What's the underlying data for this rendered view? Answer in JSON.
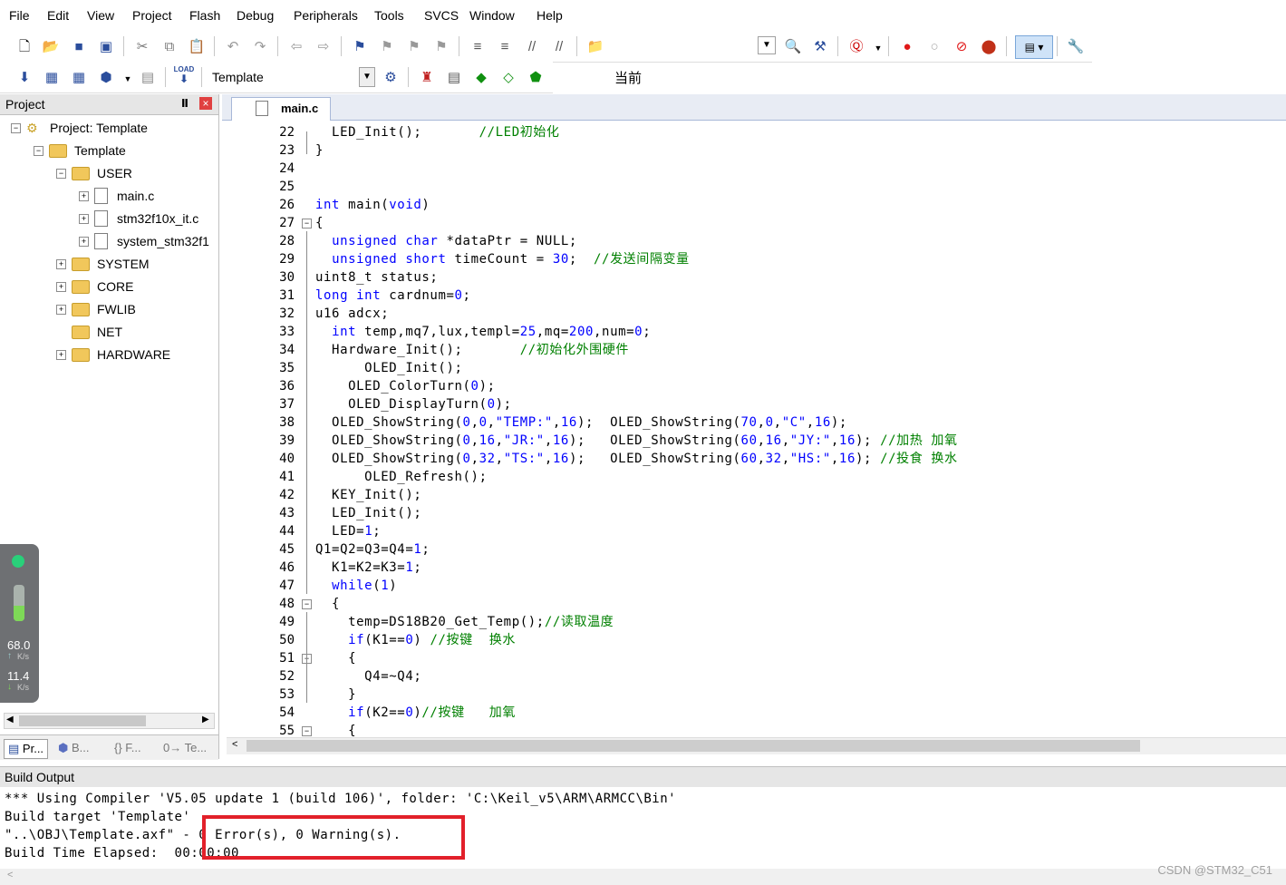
{
  "menu": [
    "File",
    "Edit",
    "View",
    "Project",
    "Flash",
    "Debug",
    "Peripherals",
    "Tools",
    "SVCS",
    "Window",
    "Help"
  ],
  "toolbar1": {
    "combo_value": "当前"
  },
  "toolbar2": {
    "target_combo": "Template",
    "load_label": "LOAD"
  },
  "project_panel": {
    "title": "Project",
    "pin_glyph": "Ⅱ",
    "close_glyph": "×",
    "tree": [
      {
        "label": "Project: Template",
        "level": 0,
        "type": "project",
        "expanded": true
      },
      {
        "label": "Template",
        "level": 1,
        "type": "target",
        "expanded": true
      },
      {
        "label": "USER",
        "level": 2,
        "type": "folder",
        "expanded": true
      },
      {
        "label": "main.c",
        "level": 3,
        "type": "file"
      },
      {
        "label": "stm32f10x_it.c",
        "level": 3,
        "type": "file"
      },
      {
        "label": "system_stm32f1",
        "level": 3,
        "type": "file"
      },
      {
        "label": "SYSTEM",
        "level": 2,
        "type": "folder",
        "expanded": false
      },
      {
        "label": "CORE",
        "level": 2,
        "type": "folder",
        "expanded": false
      },
      {
        "label": "FWLIB",
        "level": 2,
        "type": "folder",
        "expanded": false
      },
      {
        "label": "NET",
        "level": 2,
        "type": "folder",
        "expanded": null
      },
      {
        "label": "HARDWARE",
        "level": 2,
        "type": "folder",
        "expanded": false
      }
    ],
    "tabs": [
      "Pr...",
      "B...",
      "{} F...",
      "0→ Te..."
    ]
  },
  "net_widget": {
    "up_value": "68.0",
    "up_unit": "K/s",
    "down_value": "11.4",
    "down_unit": "K/s"
  },
  "editor": {
    "active_tab": "main.c",
    "lines": [
      {
        "n": 22,
        "t": "  LED_Init();       //LED初始化"
      },
      {
        "n": 23,
        "t": "}"
      },
      {
        "n": 24,
        "t": ""
      },
      {
        "n": 25,
        "t": ""
      },
      {
        "n": 26,
        "t": "int main(void)"
      },
      {
        "n": 27,
        "t": "{"
      },
      {
        "n": 28,
        "t": "  unsigned char *dataPtr = NULL;"
      },
      {
        "n": 29,
        "t": "  unsigned short timeCount = 30;  //发送间隔变量"
      },
      {
        "n": 30,
        "t": "uint8_t status;"
      },
      {
        "n": 31,
        "t": "long int cardnum=0;"
      },
      {
        "n": 32,
        "t": "u16 adcx;"
      },
      {
        "n": 33,
        "t": "  int temp,mq7,lux,templ=25,mq=200,num=0;"
      },
      {
        "n": 34,
        "t": "  Hardware_Init();       //初始化外围硬件"
      },
      {
        "n": 35,
        "t": "      OLED_Init();"
      },
      {
        "n": 36,
        "t": "    OLED_ColorTurn(0);"
      },
      {
        "n": 37,
        "t": "    OLED_DisplayTurn(0);"
      },
      {
        "n": 38,
        "t": "  OLED_ShowString(0,0,\"TEMP:\",16);  OLED_ShowString(70,0,\"C\",16);"
      },
      {
        "n": 39,
        "t": "  OLED_ShowString(0,16,\"JR:\",16);   OLED_ShowString(60,16,\"JY:\",16); //加热 加氧"
      },
      {
        "n": 40,
        "t": "  OLED_ShowString(0,32,\"TS:\",16);   OLED_ShowString(60,32,\"HS:\",16); //投食 换水"
      },
      {
        "n": 41,
        "t": "      OLED_Refresh();"
      },
      {
        "n": 42,
        "t": "  KEY_Init();"
      },
      {
        "n": 43,
        "t": "  LED_Init();"
      },
      {
        "n": 44,
        "t": "  LED=1;"
      },
      {
        "n": 45,
        "t": "Q1=Q2=Q3=Q4=1;"
      },
      {
        "n": 46,
        "t": "  K1=K2=K3=1;"
      },
      {
        "n": 47,
        "t": "  while(1)"
      },
      {
        "n": 48,
        "t": "  {"
      },
      {
        "n": 49,
        "t": "    temp=DS18B20_Get_Temp();//读取温度"
      },
      {
        "n": 50,
        "t": "    if(K1==0) //按键  换水"
      },
      {
        "n": 51,
        "t": "    {"
      },
      {
        "n": 52,
        "t": "      Q4=~Q4;"
      },
      {
        "n": 53,
        "t": "    }"
      },
      {
        "n": 54,
        "t": "    if(K2==0)//按键   加氧"
      },
      {
        "n": 55,
        "t": "    {"
      }
    ]
  },
  "build_output": {
    "title": "Build Output",
    "lines": [
      "*** Using Compiler 'V5.05 update 1 (build 106)', folder: 'C:\\Keil_v5\\ARM\\ARMCC\\Bin'",
      "Build target 'Template'",
      "\"..\\OBJ\\Template.axf\" - 0 Error(s), 0 Warning(s).",
      "Build Time Elapsed:  00:00:00"
    ]
  },
  "watermark": "CSDN @STM32_C51",
  "colors": {
    "keyword": "#0000ff",
    "comment": "#008000",
    "highlight_box": "#e2202a"
  }
}
